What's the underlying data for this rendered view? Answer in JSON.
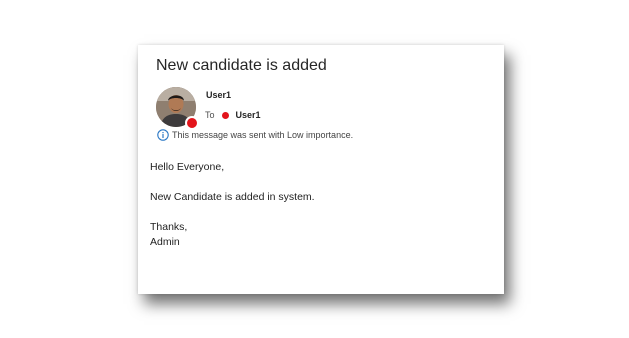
{
  "message": {
    "subject": "New candidate is added",
    "sender": {
      "name": "User1",
      "presence": "busy",
      "presence_color": "#e3141b"
    },
    "recipients": {
      "to_label": "To",
      "to": [
        {
          "name": "User1",
          "presence": "busy",
          "presence_color": "#e3141b"
        }
      ]
    },
    "info_bar": {
      "icon": "info-icon",
      "text": "This message was sent with Low importance."
    },
    "body": {
      "greeting": "Hello Everyone,",
      "line1": "New Candidate is added in system.",
      "closing": "Thanks,",
      "signature": "Admin"
    }
  },
  "colors": {
    "accent_info": "#2b78c5",
    "text_primary": "#262626"
  }
}
